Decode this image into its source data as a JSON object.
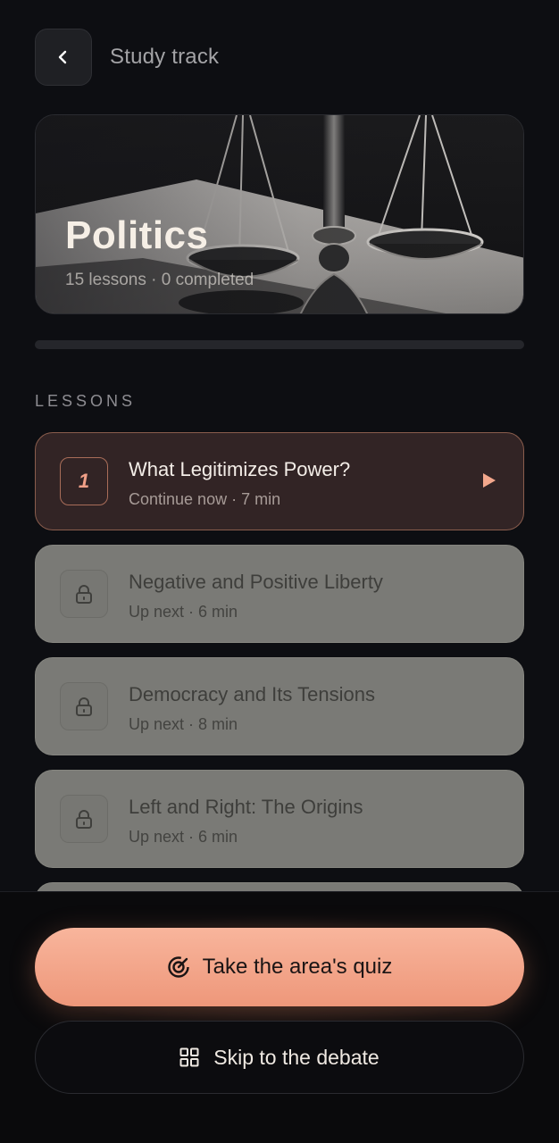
{
  "header": {
    "title": "Study track"
  },
  "hero": {
    "title": "Politics",
    "subtitle": "15 lessons · 0 completed"
  },
  "progress": {
    "fraction": 0
  },
  "section": {
    "label": "LESSONS"
  },
  "lessons": [
    {
      "badge": "1",
      "title": "What Legitimizes Power?",
      "meta": "Continue now · 7 min",
      "state": "active"
    },
    {
      "title": "Negative and Positive Liberty",
      "meta": "Up next · 6 min",
      "state": "locked"
    },
    {
      "title": "Democracy and Its Tensions",
      "meta": "Up next · 8 min",
      "state": "locked"
    },
    {
      "title": "Left and Right: The Origins",
      "meta": "Up next · 6 min",
      "state": "locked"
    }
  ],
  "actions": {
    "quiz_label": "Take the area's quiz",
    "debate_label": "Skip to the debate"
  },
  "icons": {
    "back": "chevron-left-icon",
    "play": "play-icon",
    "lock": "lock-icon",
    "quiz": "target-icon",
    "debate": "grid-icon"
  },
  "colors": {
    "accent": "#f0a58a",
    "background": "#0d0e12",
    "active_card": "#322425",
    "locked_card": "#7a7a76"
  }
}
